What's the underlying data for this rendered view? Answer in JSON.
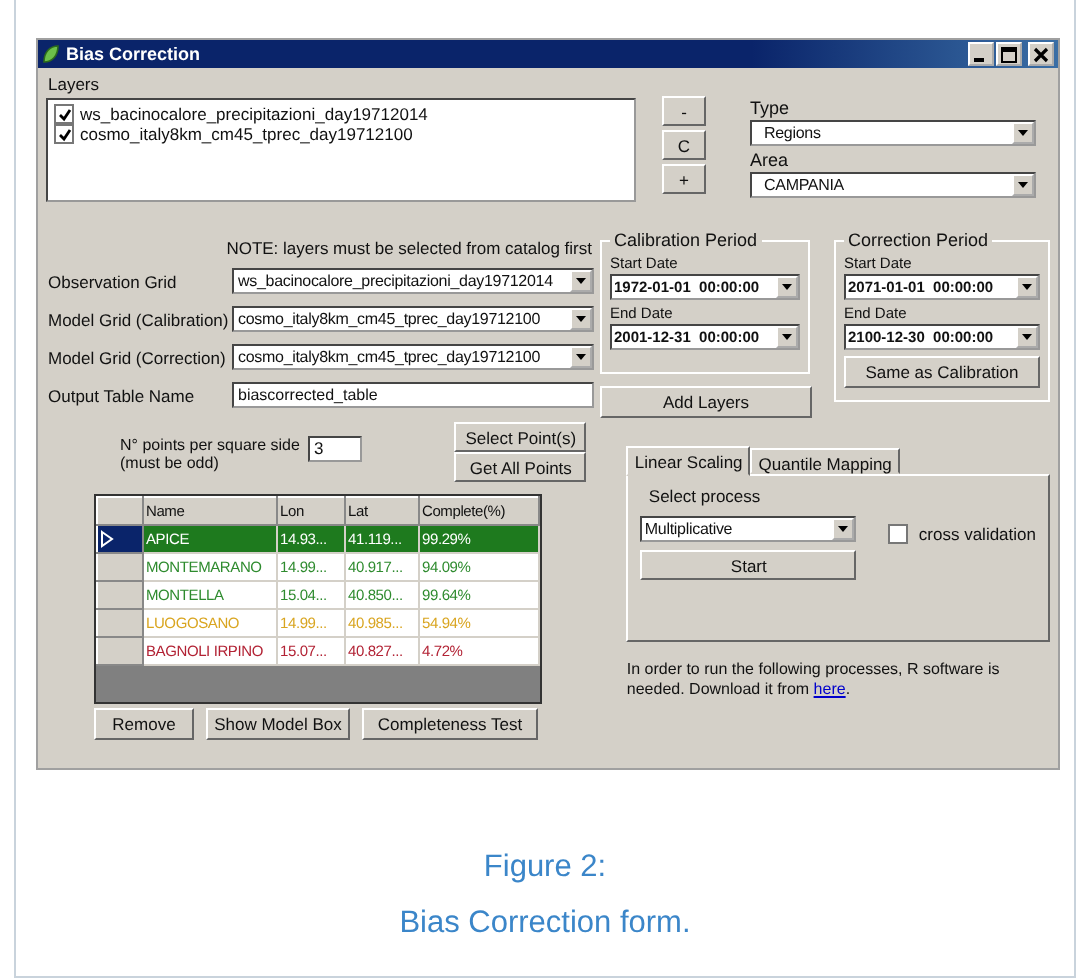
{
  "window": {
    "title": "Bias Correction"
  },
  "layers": {
    "label": "Layers",
    "items": [
      {
        "name": "ws_bacinocalore_precipitazioni_day19712014",
        "checked": true
      },
      {
        "name": "cosmo_italy8km_cm45_tprec_day19712100",
        "checked": true
      }
    ]
  },
  "layer_buttons": [
    "-",
    "C",
    "+"
  ],
  "type": {
    "label": "Type",
    "value": "Regions"
  },
  "area": {
    "label": "Area",
    "value": "CAMPANIA"
  },
  "note": "NOTE: layers must be selected from catalog first",
  "grids": [
    {
      "kind": "dropdown",
      "label": "Observation Grid",
      "value": "ws_bacinocalore_precipitazioni_day19712014"
    },
    {
      "kind": "dropdown",
      "label": "Model Grid (Calibration)",
      "value": "cosmo_italy8km_cm45_tprec_day19712100"
    },
    {
      "kind": "dropdown",
      "label": "Model Grid (Correction)",
      "value": "cosmo_italy8km_cm45_tprec_day19712100"
    },
    {
      "kind": "text",
      "label": "Output Table Name",
      "value": "biascorrected_table"
    }
  ],
  "calibration_period": {
    "title": "Calibration Period",
    "start_label": "Start Date",
    "start": "1972-01-01  00:00:00",
    "end_label": "End Date",
    "end": "2001-12-31  00:00:00"
  },
  "correction_period": {
    "title": "Correction Period",
    "start_label": "Start Date",
    "start": "2071-01-01  00:00:00",
    "end_label": "End Date",
    "end": "2100-12-30  00:00:00",
    "button": "Same as Calibration"
  },
  "add_layers_button": "Add Layers",
  "points": {
    "label": "N° points per square side",
    "hint": "(must be odd)",
    "value": "3"
  },
  "point_buttons": [
    "Select Point(s)",
    "Get All Points"
  ],
  "table": {
    "columns": [
      "Name",
      "Lon",
      "Lat",
      "Complete(%)"
    ],
    "rows": [
      {
        "selected": true,
        "color": "#1e7a1e",
        "cells": [
          "APICE",
          "14.93...",
          "41.119...",
          "99.29%"
        ]
      },
      {
        "selected": false,
        "color": "#2e8b2e",
        "cells": [
          "MONTEMARANO",
          "14.99...",
          "40.917...",
          "94.09%"
        ]
      },
      {
        "selected": false,
        "color": "#2e8b2e",
        "cells": [
          "MONTELLA",
          "15.04...",
          "40.850...",
          "99.64%"
        ]
      },
      {
        "selected": false,
        "color": "#d9a520",
        "cells": [
          "LUOGOSANO",
          "14.99...",
          "40.985...",
          "54.94%"
        ]
      },
      {
        "selected": false,
        "color": "#b22234",
        "cells": [
          "BAGNOLI IRPINO",
          "15.07...",
          "40.827...",
          "4.72%"
        ]
      }
    ]
  },
  "bottom_buttons": [
    "Remove",
    "Show Model Box",
    "Completeness Test"
  ],
  "tabs": [
    {
      "label": "Linear Scaling",
      "selected": true
    },
    {
      "label": "Quantile Mapping",
      "selected": false
    }
  ],
  "process": {
    "label": "Select process",
    "value": "Multiplicative"
  },
  "start_button": "Start",
  "cross_validation": {
    "label": "cross validation",
    "checked": false
  },
  "info": {
    "text": "In order to run the following processes, R software is needed. Download it from",
    "link": "here",
    "after": "."
  },
  "caption": [
    "Figure 2:",
    "Bias Correction form."
  ]
}
